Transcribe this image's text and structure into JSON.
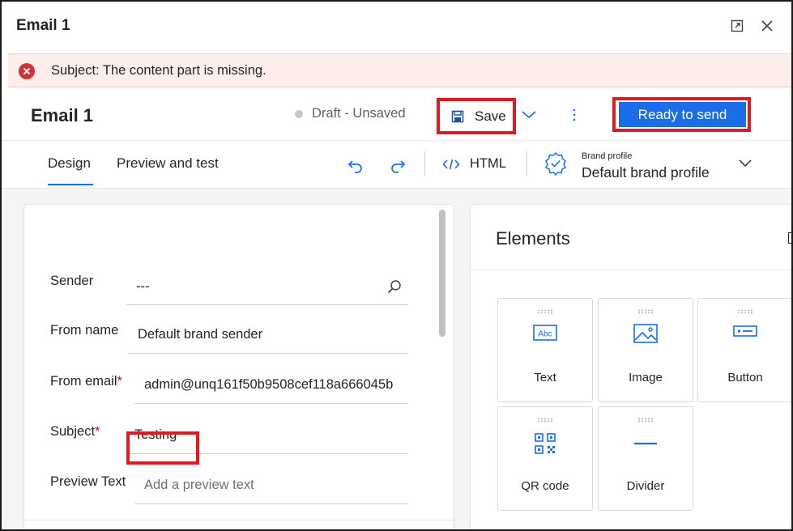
{
  "window": {
    "title": "Email 1"
  },
  "banner": {
    "message": "Subject: The content part is missing."
  },
  "header": {
    "title": "Email 1",
    "status": "Draft - Unsaved",
    "save_label": "Save",
    "ready_label": "Ready to send"
  },
  "tabs": [
    {
      "label": "Design",
      "active": true
    },
    {
      "label": "Preview and test",
      "active": false
    }
  ],
  "toolbar": {
    "html_label": "HTML",
    "brand_profile_caption": "Brand profile",
    "brand_profile_value": "Default brand profile"
  },
  "form": {
    "sender": {
      "label": "Sender",
      "value": "---"
    },
    "from_name": {
      "label": "From name",
      "value": "Default brand sender"
    },
    "from_email": {
      "label": "From email",
      "required_mark": "*",
      "value": "admin@unq161f50b9508cef118a666045b"
    },
    "subject": {
      "label": "Subject",
      "required_mark": "*",
      "value": "Testing"
    },
    "preview_text": {
      "label": "Preview Text",
      "placeholder": "Add a preview text"
    }
  },
  "elements": {
    "title": "Elements",
    "items": [
      {
        "label": "Text",
        "icon": "text-icon"
      },
      {
        "label": "Image",
        "icon": "image-icon"
      },
      {
        "label": "Button",
        "icon": "button-icon"
      },
      {
        "label": "QR code",
        "icon": "qr-code-icon"
      },
      {
        "label": "Divider",
        "icon": "divider-icon"
      }
    ]
  },
  "colors": {
    "accent": "#1b6ee8",
    "error": "#d13438",
    "highlight": "#e11a22",
    "banner_bg": "#fdeeec"
  }
}
